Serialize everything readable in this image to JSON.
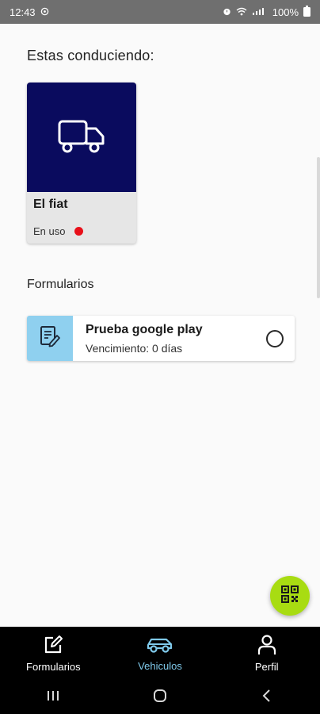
{
  "status_bar": {
    "time": "12:43",
    "battery": "100%"
  },
  "driving": {
    "title": "Estas conduciendo:",
    "vehicle": {
      "name": "El fiat",
      "status": "En uso",
      "image_color": "#0a0b5e",
      "status_color": "#e8101a",
      "icon": "truck-icon"
    }
  },
  "forms": {
    "title": "Formularios",
    "items": [
      {
        "name": "Prueba google play",
        "due": "Vencimiento: 0 días",
        "icon": "document-edit-icon",
        "icon_bg": "#8fd0ef"
      }
    ]
  },
  "fab": {
    "icon": "qr-code-icon",
    "color": "#a8dc12"
  },
  "bottom_nav": {
    "items": [
      {
        "label": "Formularios",
        "icon": "edit-square-icon",
        "active": false
      },
      {
        "label": "Vehiculos",
        "icon": "car-icon",
        "active": true
      },
      {
        "label": "Perfil",
        "icon": "person-icon",
        "active": false
      }
    ],
    "active_color": "#7fc9ea"
  }
}
